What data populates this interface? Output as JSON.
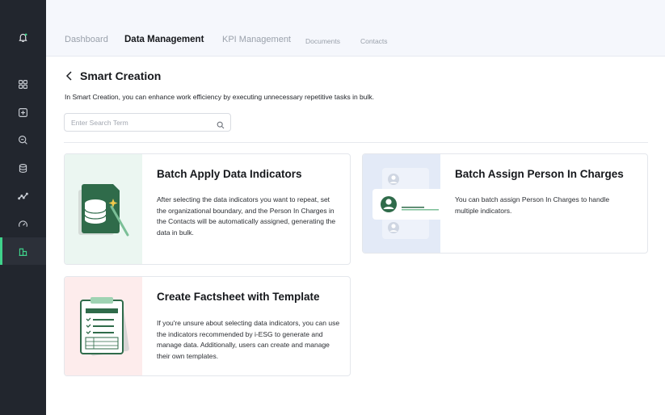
{
  "sidebar": {
    "icons": [
      {
        "name": "bell-icon"
      },
      {
        "name": "dashboard-grid-icon"
      },
      {
        "name": "add-box-icon"
      },
      {
        "name": "search-zoom-icon"
      },
      {
        "name": "database-icon"
      },
      {
        "name": "trend-line-icon"
      },
      {
        "name": "gauge-icon"
      },
      {
        "name": "buildings-icon",
        "active": true
      }
    ],
    "accent_color": "#3fd28b"
  },
  "nav": {
    "tabs": [
      {
        "label": "Dashboard"
      },
      {
        "label": "Data Management",
        "active": true
      },
      {
        "label": "KPI Management"
      },
      {
        "label": "Documents"
      },
      {
        "label": "Contacts"
      }
    ]
  },
  "page": {
    "title": "Smart Creation",
    "subtitle": "In Smart Creation, you can enhance work efficiency by executing unnecessary repetitive tasks in bulk."
  },
  "search": {
    "placeholder": "Enter Search Term",
    "value": ""
  },
  "cards": [
    {
      "title": "Batch Apply Data Indicators",
      "description": "After selecting the data indicators you want to repeat, set the organizational boundary, and the Person In Charges in the Contacts will be automatically assigned, generating the data in bulk.",
      "icon": "database-wand-icon",
      "bg": "#ebf6f1"
    },
    {
      "title": "Batch Assign Person In Charges",
      "description": "You can batch assign Person In Charges to handle multiple indicators.",
      "icon": "assign-people-icon",
      "bg": "#e3eaf7"
    },
    {
      "title": "Create Factsheet with Template",
      "description": "If you're unsure about selecting data indicators, you can use the indicators recommended by i-ESG to generate and manage data. Additionally, users can create and manage their own templates.",
      "icon": "clipboard-template-icon",
      "bg": "#fdecec"
    }
  ]
}
